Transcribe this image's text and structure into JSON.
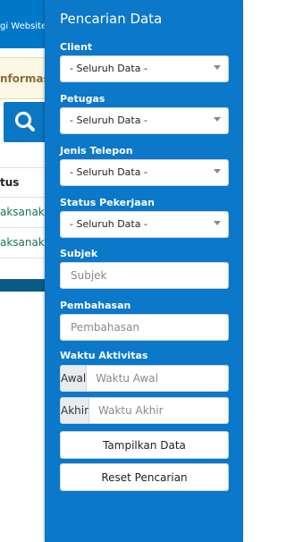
{
  "background": {
    "topbar_text": "gi Website",
    "info_text": "nformasi",
    "table_header": "tus",
    "rows": [
      "aksanako",
      "aksanako"
    ],
    "search_icon": "search-icon"
  },
  "panel": {
    "title": "Pencarian Data",
    "client": {
      "label": "Client",
      "value": "- Seluruh Data -"
    },
    "petugas": {
      "label": "Petugas",
      "value": "- Seluruh Data -"
    },
    "jenis_telepon": {
      "label": "Jenis Telepon",
      "value": "- Seluruh Data -"
    },
    "status_pekerjaan": {
      "label": "Status Pekerjaan",
      "value": "- Seluruh Data -"
    },
    "subjek": {
      "label": "Subjek",
      "placeholder": "Subjek"
    },
    "pembahasan": {
      "label": "Pembahasan",
      "placeholder": "Pembahasan"
    },
    "waktu": {
      "label": "Waktu Aktivitas",
      "awal_addon": "Awal",
      "awal_placeholder": "Waktu Awal",
      "akhir_addon": "Akhir",
      "akhir_placeholder": "Waktu Akhir"
    },
    "show_button": "Tampilkan Data",
    "reset_button": "Reset Pencarian"
  },
  "colors": {
    "panel_bg": "#0b78c9",
    "topbar_bg": "#0078c8",
    "info_bg": "#fcf8e3",
    "status_text": "#17725d"
  }
}
